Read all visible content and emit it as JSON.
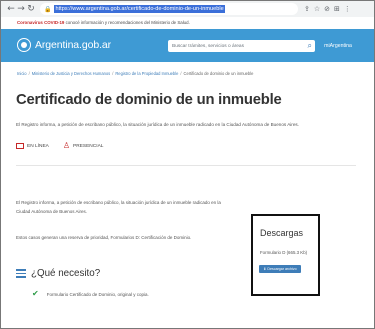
{
  "browser": {
    "url": "https://www.argentina.gob.ar/certificado-de-dominio-de-un-inmueble",
    "icons": [
      "back-icon",
      "forward-icon",
      "reload-icon",
      "lock-icon",
      "share-icon",
      "star-icon",
      "extension-icon",
      "menu-icon"
    ]
  },
  "covid_bar": {
    "bold": "Coronavirus COVID-19",
    "text": " conocé información y recomendaciones del Ministerio de Salud."
  },
  "header": {
    "logo_text": "Argentina.gob.ar",
    "search_placeholder": "Buscar trámites, servicios o áreas",
    "mi_argentina": "miArgentina"
  },
  "breadcrumb": [
    "Inicio",
    "Ministerio de Justicia y Derechos Humanos",
    "Registro de la Propiedad Inmueble",
    "Certificado de dominio de un inmueble"
  ],
  "page": {
    "title": "Certificado de dominio de un inmueble",
    "lead": "El Registro informa, a petición de escribano público, la situación jurídica de un inmueble radicado en la Ciudad Autónoma de Buenos Aires.",
    "mode_online": "EN LÍNEA",
    "mode_presencial": "PRESENCIAL",
    "body1": "El Registro informa, a petición de escribano público, la situación jurídica de un inmueble radicado en la Ciudad Autónoma de Buenos Aires.",
    "body2": "Estos casos generan una reserva de prioridad, Formularios D: Certificación de Dominio.",
    "need_title": "¿Qué necesito?",
    "requirement": "Formulario Certificado de Dominio, original y copia."
  },
  "downloads": {
    "title": "Descargas",
    "file": "Formulario D (665.3 Kb)",
    "button": "Descargar archivo"
  },
  "colors": {
    "header_blue": "#3e9ad4",
    "link_blue": "#3e7db8",
    "accent_red": "#c62828",
    "check_green": "#2e9c49"
  }
}
